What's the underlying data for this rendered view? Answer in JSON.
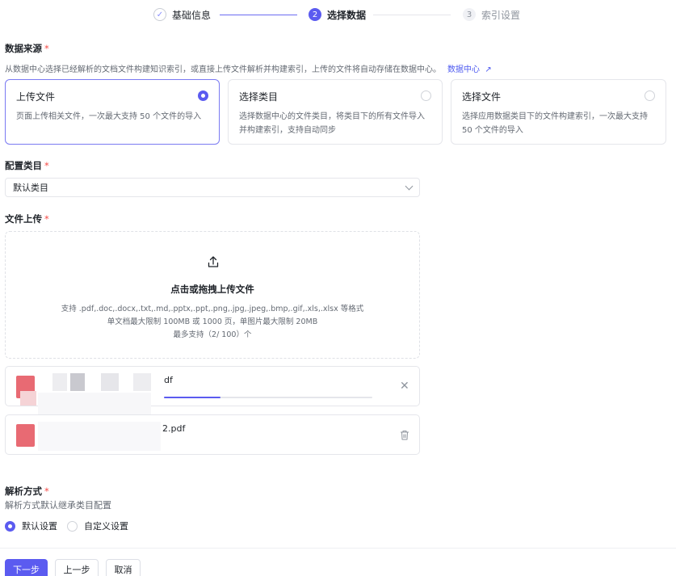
{
  "steps": [
    {
      "index": "✓",
      "label": "基础信息"
    },
    {
      "index": "2",
      "label": "选择数据"
    },
    {
      "index": "3",
      "label": "索引设置"
    }
  ],
  "data_source": {
    "label": "数据来源",
    "required": "*",
    "description": "从数据中心选择已经解析的文档文件构建知识索引，或直接上传文件解析并构建索引，上传的文件将自动存储在数据中心。",
    "link_label": "数据中心",
    "link_icon": "↗",
    "options": [
      {
        "title": "上传文件",
        "desc": "页面上传相关文件，一次最大支持 50 个文件的导入",
        "selected": true
      },
      {
        "title": "选择类目",
        "desc": "选择数据中心的文件类目，将类目下的所有文件导入并构建索引，支持自动同步",
        "selected": false
      },
      {
        "title": "选择文件",
        "desc": "选择应用数据类目下的文件构建索引，一次最大支持 50 个文件的导入",
        "selected": false
      }
    ]
  },
  "category": {
    "label": "配置类目",
    "required": "*",
    "selected": "默认类目"
  },
  "upload": {
    "label": "文件上传",
    "required": "*",
    "title": "点击或拖拽上传文件",
    "hint1": "支持 .pdf,.doc,.docx,.txt,.md,.pptx,.ppt,.png,.jpg,.jpeg,.bmp,.gif,.xls,.xlsx 等格式",
    "hint2": "单文档最大限制 100MB 或 1000 页，单图片最大限制 20MB",
    "hint3": "最多支持（2/ 100）个"
  },
  "files": [
    {
      "name_suffix": "df",
      "progress": 0.27,
      "action": "close-icon"
    },
    {
      "name_suffix": "2.pdf",
      "action": "trash-icon"
    }
  ],
  "parse": {
    "label": "解析方式",
    "required": "*",
    "description": "解析方式默认继承类目配置",
    "options": [
      {
        "label": "默认设置",
        "selected": true
      },
      {
        "label": "自定义设置",
        "selected": false
      }
    ]
  },
  "buttons": {
    "next": "下一步",
    "prev": "上一步",
    "cancel": "取消"
  },
  "colors": {
    "accent": "#5b5bf0",
    "required": "#f54a45",
    "file_icon": "#e86a73"
  }
}
